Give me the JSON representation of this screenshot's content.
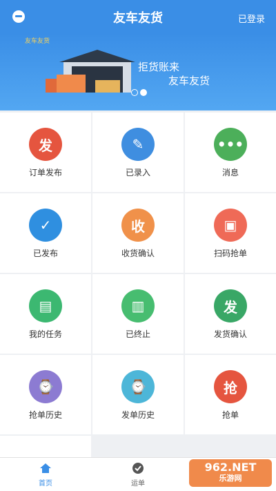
{
  "topbar": {
    "title": "友车友货",
    "login": "已登录"
  },
  "banner": {
    "logo": "友车友货",
    "slogan1": "拒货账来",
    "slogan2": "友车友货"
  },
  "grid": [
    {
      "label": "订单发布",
      "glyph": "发",
      "color": "#e5553f",
      "icon": "publish-order-icon"
    },
    {
      "label": "已录入",
      "glyph": "✎",
      "color": "#3f8ee0",
      "icon": "edit-icon"
    },
    {
      "label": "消息",
      "glyph": "•••",
      "color": "#4caf5a",
      "icon": "message-icon"
    },
    {
      "label": "已发布",
      "glyph": "✓",
      "color": "#2f8fe0",
      "icon": "clipboard-check-icon"
    },
    {
      "label": "收货确认",
      "glyph": "收",
      "color": "#f0914a",
      "icon": "receive-confirm-icon"
    },
    {
      "label": "扫码抢单",
      "glyph": "▣",
      "color": "#ef6a57",
      "icon": "scan-icon"
    },
    {
      "label": "我的任务",
      "glyph": "▤",
      "color": "#3cb871",
      "icon": "task-icon"
    },
    {
      "label": "已终止",
      "glyph": "▥",
      "color": "#47bd70",
      "icon": "terminated-icon"
    },
    {
      "label": "发货确认",
      "glyph": "发",
      "color": "#39a766",
      "icon": "ship-confirm-icon"
    },
    {
      "label": "抢单历史",
      "glyph": "⌚",
      "color": "#8c7bd2",
      "icon": "grab-history-icon"
    },
    {
      "label": "发单历史",
      "glyph": "⌚",
      "color": "#4db6d8",
      "icon": "order-history-icon"
    },
    {
      "label": "抢单",
      "glyph": "抢",
      "color": "#e5553f",
      "icon": "grab-icon"
    }
  ],
  "bottombar": {
    "tabs": [
      {
        "label": "首页",
        "icon": "home-icon",
        "active": true
      },
      {
        "label": "运单",
        "icon": "waybill-icon",
        "active": false
      }
    ]
  },
  "watermark": {
    "line1": "962.NET",
    "line2": "乐游网"
  }
}
